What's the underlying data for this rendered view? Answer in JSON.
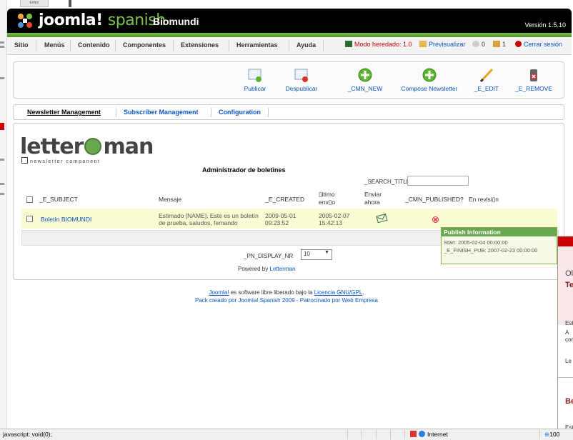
{
  "browser_stub": {
    "label": "Editor"
  },
  "header": {
    "brand_main": "joomla!",
    "brand_sub": "spanish",
    "site_name": "Biomundi",
    "version": "Versión 1.5.10"
  },
  "menubar": {
    "items": [
      "Sitio",
      "Menús",
      "Contenido",
      "Componentes",
      "Extensiones",
      "Herramientas",
      "Ayuda"
    ],
    "legacy_mode": "Modo heredado: 1.0",
    "preview": "Previsualizar",
    "messages_count": "0",
    "users_count": "1",
    "logout": "Cerrar sesión"
  },
  "toolbar": {
    "buttons": [
      "Publicar",
      "Despublicar",
      "_CMN_NEW",
      "Compose Newsletter",
      "_E_EDIT",
      "_E_REMOVE"
    ]
  },
  "submenu": {
    "items": [
      "Newsletter Management",
      "Subscriber Management",
      "Configuration"
    ]
  },
  "logo": {
    "left": "letter",
    "right": "man",
    "tagline": "newsletter component"
  },
  "main": {
    "title": "Administrador de boletines",
    "search_label": "_SEARCH_TITLE:",
    "search_value": "",
    "columns": [
      "_E_SUBJECT",
      "Mensaje",
      "_E_CREATED",
      "\u0000ltimo env\u0000o",
      "Enviar ahora",
      "_CMN_PUBLISHED?",
      "En revisi\u0000n"
    ],
    "col_last_sent_1": "▯ltimo",
    "col_last_sent_2": "env▯o",
    "col_send_1": "Enviar",
    "col_send_2": "ahora",
    "col_review": "En revisi▯n",
    "rows": [
      {
        "subject": "Boletín BIOMUNDI",
        "message_1": "Estimado [NAME], Este es un boletín",
        "message_2": "de prueba, saludos, fernando",
        "created_1": "2009-05-01",
        "created_2": "09:23:52",
        "sent_1": "2005-02-07",
        "sent_2": "15:42:13"
      }
    ],
    "pn_label": "_PN_DISPLAY_NR",
    "pn_value": "10",
    "powered_prefix": "Powered by",
    "powered_link": "Letterman"
  },
  "tooltip": {
    "title": "Publish Information",
    "start": "Start: 2005-02-04 00:00:00",
    "finish": "_E_FINISH_PUB: 2007-02-23 00:00:00"
  },
  "footer": {
    "line1_a": "Joomla!",
    "line1_b": " es software libre liberado bajo la ",
    "line1_link": "Licencia GNU/GPL",
    "line1_end": ".",
    "line2": "Pack creado por Joomla! Spanish 2009 - Patrocinado por Web Empresa"
  },
  "overlay": {
    "t1": "Ol",
    "t2": "Te",
    "s1": "Est",
    "s2": "A",
    "s3": "cor",
    "s4": "Le",
    "t3": "Be",
    "s5": "Est"
  },
  "statusbar": {
    "text": "javascript: void(0);",
    "zone": "Internet",
    "zoom": "100"
  },
  "colors": {
    "accent": "#7cc245",
    "link": "#0b55c4",
    "header": "#000000",
    "row_highlight": "#fbfbd4"
  }
}
